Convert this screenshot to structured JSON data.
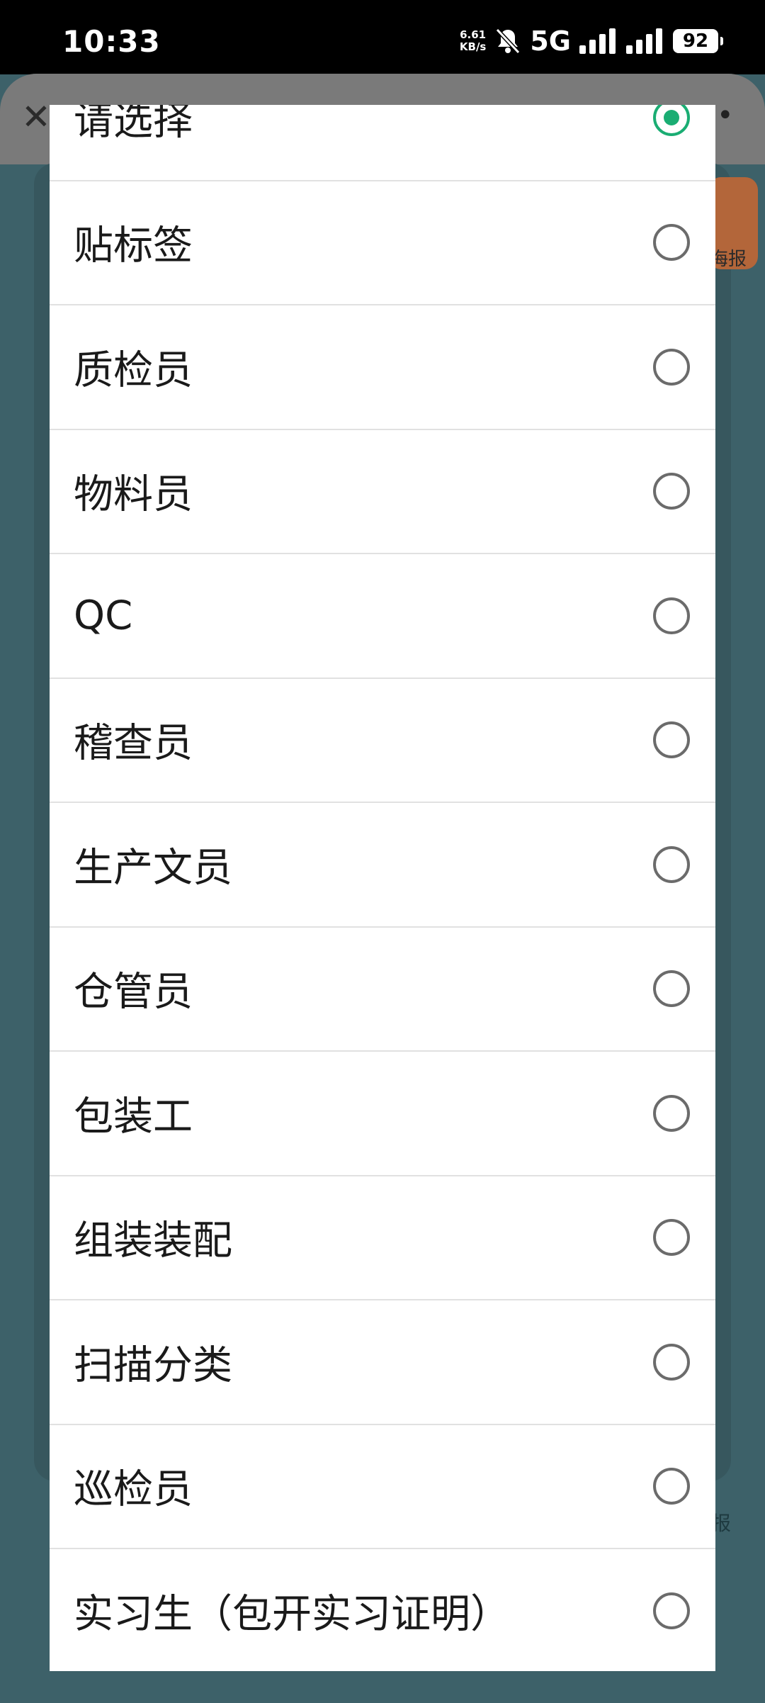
{
  "status_bar": {
    "time": "10:33",
    "net_speed_value": "6.61",
    "net_speed_unit": "KB/s",
    "network_type": "5G",
    "battery": "92"
  },
  "background": {
    "badge_label": "海报",
    "side_label": "报"
  },
  "picker": {
    "options": [
      {
        "label": "请选择",
        "selected": true
      },
      {
        "label": "贴标签",
        "selected": false
      },
      {
        "label": "质检员",
        "selected": false
      },
      {
        "label": "物料员",
        "selected": false
      },
      {
        "label": "QC",
        "selected": false
      },
      {
        "label": "稽查员",
        "selected": false
      },
      {
        "label": "生产文员",
        "selected": false
      },
      {
        "label": "仓管员",
        "selected": false
      },
      {
        "label": "包装工",
        "selected": false
      },
      {
        "label": "组装装配",
        "selected": false
      },
      {
        "label": "扫描分类",
        "selected": false
      },
      {
        "label": "巡检员",
        "selected": false
      },
      {
        "label": "实习生（包开实习证明）",
        "selected": false
      }
    ]
  },
  "colors": {
    "accent": "#1aad73",
    "overlay_bg": "#3d6169"
  }
}
